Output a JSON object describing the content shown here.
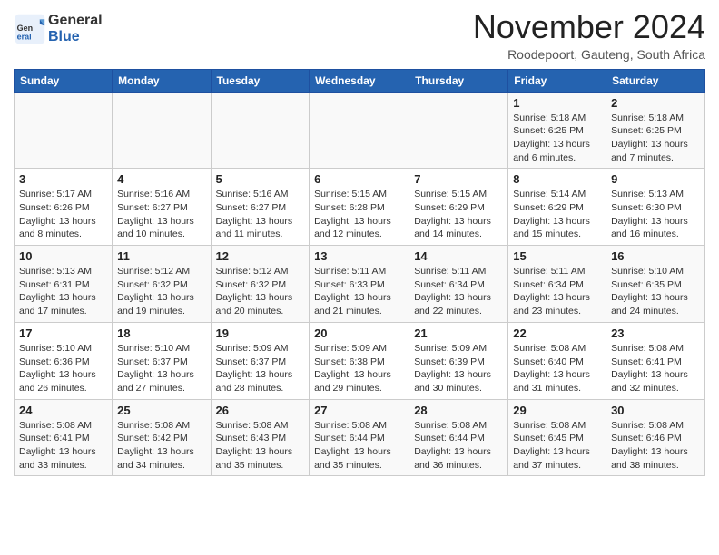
{
  "logo": {
    "general": "General",
    "blue": "Blue"
  },
  "title": "November 2024",
  "location": "Roodepoort, Gauteng, South Africa",
  "days_of_week": [
    "Sunday",
    "Monday",
    "Tuesday",
    "Wednesday",
    "Thursday",
    "Friday",
    "Saturday"
  ],
  "weeks": [
    [
      {
        "day": "",
        "info": ""
      },
      {
        "day": "",
        "info": ""
      },
      {
        "day": "",
        "info": ""
      },
      {
        "day": "",
        "info": ""
      },
      {
        "day": "",
        "info": ""
      },
      {
        "day": "1",
        "info": "Sunrise: 5:18 AM\nSunset: 6:25 PM\nDaylight: 13 hours and 6 minutes."
      },
      {
        "day": "2",
        "info": "Sunrise: 5:18 AM\nSunset: 6:25 PM\nDaylight: 13 hours and 7 minutes."
      }
    ],
    [
      {
        "day": "3",
        "info": "Sunrise: 5:17 AM\nSunset: 6:26 PM\nDaylight: 13 hours and 8 minutes."
      },
      {
        "day": "4",
        "info": "Sunrise: 5:16 AM\nSunset: 6:27 PM\nDaylight: 13 hours and 10 minutes."
      },
      {
        "day": "5",
        "info": "Sunrise: 5:16 AM\nSunset: 6:27 PM\nDaylight: 13 hours and 11 minutes."
      },
      {
        "day": "6",
        "info": "Sunrise: 5:15 AM\nSunset: 6:28 PM\nDaylight: 13 hours and 12 minutes."
      },
      {
        "day": "7",
        "info": "Sunrise: 5:15 AM\nSunset: 6:29 PM\nDaylight: 13 hours and 14 minutes."
      },
      {
        "day": "8",
        "info": "Sunrise: 5:14 AM\nSunset: 6:29 PM\nDaylight: 13 hours and 15 minutes."
      },
      {
        "day": "9",
        "info": "Sunrise: 5:13 AM\nSunset: 6:30 PM\nDaylight: 13 hours and 16 minutes."
      }
    ],
    [
      {
        "day": "10",
        "info": "Sunrise: 5:13 AM\nSunset: 6:31 PM\nDaylight: 13 hours and 17 minutes."
      },
      {
        "day": "11",
        "info": "Sunrise: 5:12 AM\nSunset: 6:32 PM\nDaylight: 13 hours and 19 minutes."
      },
      {
        "day": "12",
        "info": "Sunrise: 5:12 AM\nSunset: 6:32 PM\nDaylight: 13 hours and 20 minutes."
      },
      {
        "day": "13",
        "info": "Sunrise: 5:11 AM\nSunset: 6:33 PM\nDaylight: 13 hours and 21 minutes."
      },
      {
        "day": "14",
        "info": "Sunrise: 5:11 AM\nSunset: 6:34 PM\nDaylight: 13 hours and 22 minutes."
      },
      {
        "day": "15",
        "info": "Sunrise: 5:11 AM\nSunset: 6:34 PM\nDaylight: 13 hours and 23 minutes."
      },
      {
        "day": "16",
        "info": "Sunrise: 5:10 AM\nSunset: 6:35 PM\nDaylight: 13 hours and 24 minutes."
      }
    ],
    [
      {
        "day": "17",
        "info": "Sunrise: 5:10 AM\nSunset: 6:36 PM\nDaylight: 13 hours and 26 minutes."
      },
      {
        "day": "18",
        "info": "Sunrise: 5:10 AM\nSunset: 6:37 PM\nDaylight: 13 hours and 27 minutes."
      },
      {
        "day": "19",
        "info": "Sunrise: 5:09 AM\nSunset: 6:37 PM\nDaylight: 13 hours and 28 minutes."
      },
      {
        "day": "20",
        "info": "Sunrise: 5:09 AM\nSunset: 6:38 PM\nDaylight: 13 hours and 29 minutes."
      },
      {
        "day": "21",
        "info": "Sunrise: 5:09 AM\nSunset: 6:39 PM\nDaylight: 13 hours and 30 minutes."
      },
      {
        "day": "22",
        "info": "Sunrise: 5:08 AM\nSunset: 6:40 PM\nDaylight: 13 hours and 31 minutes."
      },
      {
        "day": "23",
        "info": "Sunrise: 5:08 AM\nSunset: 6:41 PM\nDaylight: 13 hours and 32 minutes."
      }
    ],
    [
      {
        "day": "24",
        "info": "Sunrise: 5:08 AM\nSunset: 6:41 PM\nDaylight: 13 hours and 33 minutes."
      },
      {
        "day": "25",
        "info": "Sunrise: 5:08 AM\nSunset: 6:42 PM\nDaylight: 13 hours and 34 minutes."
      },
      {
        "day": "26",
        "info": "Sunrise: 5:08 AM\nSunset: 6:43 PM\nDaylight: 13 hours and 35 minutes."
      },
      {
        "day": "27",
        "info": "Sunrise: 5:08 AM\nSunset: 6:44 PM\nDaylight: 13 hours and 35 minutes."
      },
      {
        "day": "28",
        "info": "Sunrise: 5:08 AM\nSunset: 6:44 PM\nDaylight: 13 hours and 36 minutes."
      },
      {
        "day": "29",
        "info": "Sunrise: 5:08 AM\nSunset: 6:45 PM\nDaylight: 13 hours and 37 minutes."
      },
      {
        "day": "30",
        "info": "Sunrise: 5:08 AM\nSunset: 6:46 PM\nDaylight: 13 hours and 38 minutes."
      }
    ]
  ]
}
